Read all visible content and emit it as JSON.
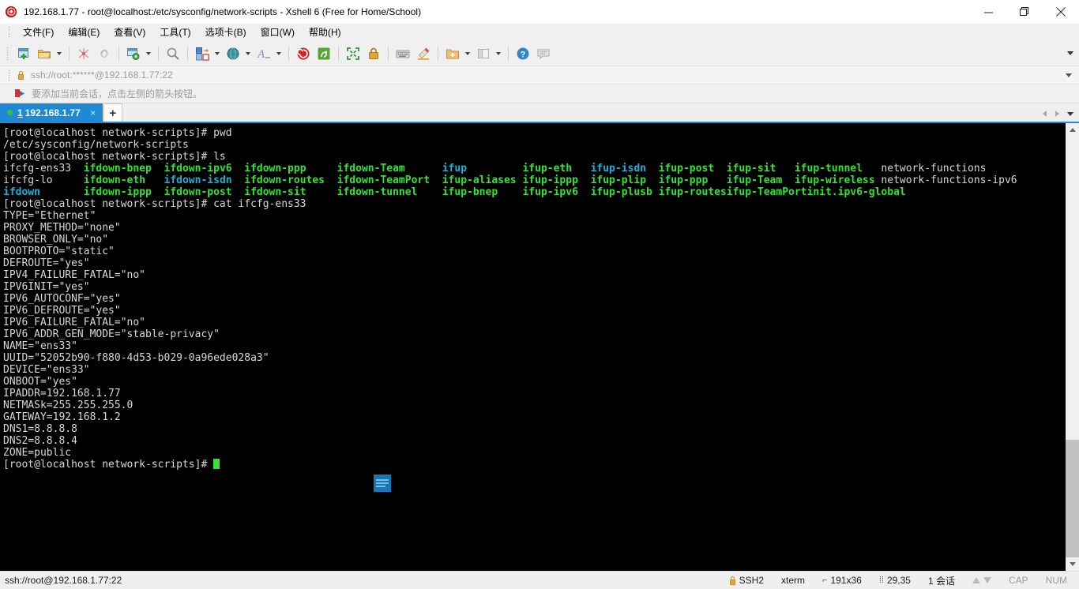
{
  "window": {
    "title": "192.168.1.77 - root@localhost:/etc/sysconfig/network-scripts - Xshell 6 (Free for Home/School)",
    "app_icon": "xshell-logo-icon",
    "minimize_label": "Minimize",
    "maximize_label": "Restore",
    "close_label": "Close"
  },
  "menubar": {
    "items": [
      {
        "label": "文件(F)",
        "name": "menu-file"
      },
      {
        "label": "编辑(E)",
        "name": "menu-edit"
      },
      {
        "label": "查看(V)",
        "name": "menu-view"
      },
      {
        "label": "工具(T)",
        "name": "menu-tools"
      },
      {
        "label": "选项卡(B)",
        "name": "menu-tabs"
      },
      {
        "label": "窗口(W)",
        "name": "menu-window"
      },
      {
        "label": "帮助(H)",
        "name": "menu-help"
      }
    ]
  },
  "toolbar": {
    "buttons": [
      {
        "name": "new-session-icon",
        "tip": "新建会话"
      },
      {
        "name": "open-folder-icon",
        "tip": "打开"
      },
      {
        "name": "disconnect-icon",
        "tip": "断开"
      },
      {
        "name": "reconnect-icon",
        "tip": "重新连接"
      },
      {
        "name": "properties-icon",
        "tip": "属性"
      },
      {
        "name": "find-icon",
        "tip": "查找"
      },
      {
        "name": "file-transfer-icon",
        "tip": "文件传输"
      },
      {
        "name": "globe-icon",
        "tip": "编码"
      },
      {
        "name": "font-icon",
        "tip": "字体"
      },
      {
        "name": "xshell-icon",
        "tip": "Xshell"
      },
      {
        "name": "xftp-icon",
        "tip": "Xftp"
      },
      {
        "name": "fullscreen-icon",
        "tip": "全屏"
      },
      {
        "name": "lock-icon",
        "tip": "锁定"
      },
      {
        "name": "keyboard-icon",
        "tip": "撰写栏"
      },
      {
        "name": "highlight-icon",
        "tip": "高亮"
      },
      {
        "name": "add-folder-icon",
        "tip": "新建文件夹"
      },
      {
        "name": "split-layout-icon",
        "tip": "排列"
      },
      {
        "name": "help-icon",
        "tip": "帮助"
      },
      {
        "name": "chat-icon",
        "tip": "消息"
      }
    ]
  },
  "addressbar": {
    "icon": "lock-icon",
    "value": "ssh://root:******@192.168.1.77:22",
    "placeholder": "ssh://root:******@192.168.1.77:22"
  },
  "notice": {
    "icon": "arrow-flag-icon",
    "text": "要添加当前会话，点击左侧的箭头按钮。"
  },
  "tabbar": {
    "tabs": [
      {
        "index": "1",
        "label": "192.168.1.77",
        "status": "connected",
        "close_label": "×"
      }
    ],
    "new_tab_label": "+",
    "scroll_left": "scroll-tabs-left-icon",
    "scroll_right": "scroll-tabs-right-icon",
    "tab_list": "tab-list-icon"
  },
  "terminal": {
    "float_icon": "compose-lines-icon",
    "lines": [
      {
        "type": "prompt",
        "prompt": "[root@localhost network-scripts]# ",
        "command": "pwd"
      },
      {
        "type": "plain",
        "text": "/etc/sysconfig/network-scripts"
      },
      {
        "type": "prompt",
        "prompt": "[root@localhost network-scripts]# ",
        "command": "ls"
      },
      {
        "type": "ls",
        "cells": [
          {
            "text": "ifcfg-ens33",
            "color": "white"
          },
          {
            "text": "ifdown-bnep",
            "color": "green"
          },
          {
            "text": "ifdown-ipv6",
            "color": "green"
          },
          {
            "text": "ifdown-ppp",
            "color": "green"
          },
          {
            "text": "ifdown-Team",
            "color": "green"
          },
          {
            "text": "ifup",
            "color": "cyan"
          },
          {
            "text": "ifup-eth",
            "color": "green"
          },
          {
            "text": "ifup-isdn",
            "color": "cyan"
          },
          {
            "text": "ifup-post",
            "color": "green"
          },
          {
            "text": "ifup-sit",
            "color": "green"
          },
          {
            "text": "ifup-tunnel",
            "color": "green"
          },
          {
            "text": "network-functions",
            "color": "white"
          }
        ]
      },
      {
        "type": "ls",
        "cells": [
          {
            "text": "ifcfg-lo",
            "color": "white"
          },
          {
            "text": "ifdown-eth",
            "color": "green"
          },
          {
            "text": "ifdown-isdn",
            "color": "cyan"
          },
          {
            "text": "ifdown-routes",
            "color": "green"
          },
          {
            "text": "ifdown-TeamPort",
            "color": "green"
          },
          {
            "text": "ifup-aliases",
            "color": "green"
          },
          {
            "text": "ifup-ippp",
            "color": "green"
          },
          {
            "text": "ifup-plip",
            "color": "green"
          },
          {
            "text": "ifup-ppp",
            "color": "green"
          },
          {
            "text": "ifup-Team",
            "color": "green"
          },
          {
            "text": "ifup-wireless",
            "color": "green"
          },
          {
            "text": "network-functions-ipv6",
            "color": "white"
          }
        ]
      },
      {
        "type": "ls",
        "cells": [
          {
            "text": "ifdown",
            "color": "cyan"
          },
          {
            "text": "ifdown-ippp",
            "color": "green"
          },
          {
            "text": "ifdown-post",
            "color": "green"
          },
          {
            "text": "ifdown-sit",
            "color": "green"
          },
          {
            "text": "ifdown-tunnel",
            "color": "green"
          },
          {
            "text": "ifup-bnep",
            "color": "green"
          },
          {
            "text": "ifup-ipv6",
            "color": "green"
          },
          {
            "text": "ifup-plusb",
            "color": "green"
          },
          {
            "text": "ifup-routes",
            "color": "green"
          },
          {
            "text": "ifup-TeamPort",
            "color": "green"
          },
          {
            "text": "init.ipv6-global",
            "color": "green"
          },
          {
            "text": "",
            "color": "white"
          }
        ]
      },
      {
        "type": "prompt",
        "prompt": "[root@localhost network-scripts]# ",
        "command": "cat ifcfg-ens33"
      },
      {
        "type": "plain",
        "text": "TYPE=\"Ethernet\""
      },
      {
        "type": "plain",
        "text": "PROXY_METHOD=\"none\""
      },
      {
        "type": "plain",
        "text": "BROWSER_ONLY=\"no\""
      },
      {
        "type": "plain",
        "text": "BOOTPROTO=\"static\""
      },
      {
        "type": "plain",
        "text": "DEFROUTE=\"yes\""
      },
      {
        "type": "plain",
        "text": "IPV4_FAILURE_FATAL=\"no\""
      },
      {
        "type": "plain",
        "text": "IPV6INIT=\"yes\""
      },
      {
        "type": "plain",
        "text": "IPV6_AUTOCONF=\"yes\""
      },
      {
        "type": "plain",
        "text": "IPV6_DEFROUTE=\"yes\""
      },
      {
        "type": "plain",
        "text": "IPV6_FAILURE_FATAL=\"no\""
      },
      {
        "type": "plain",
        "text": "IPV6_ADDR_GEN_MODE=\"stable-privacy\""
      },
      {
        "type": "plain",
        "text": "NAME=\"ens33\""
      },
      {
        "type": "plain",
        "text": "UUID=\"52052b90-f880-4d53-b029-0a96ede028a3\""
      },
      {
        "type": "plain",
        "text": "DEVICE=\"ens33\""
      },
      {
        "type": "plain",
        "text": "ONBOOT=\"yes\""
      },
      {
        "type": "plain",
        "text": "IPADDR=192.168.1.77"
      },
      {
        "type": "plain",
        "text": "NETMASk=255.255.255.0"
      },
      {
        "type": "plain",
        "text": "GATEWAY=192.168.1.2"
      },
      {
        "type": "plain",
        "text": "DNS1=8.8.8.8"
      },
      {
        "type": "plain",
        "text": "DNS2=8.8.8.4"
      },
      {
        "type": "plain",
        "text": "ZONE=public"
      },
      {
        "type": "cursor",
        "prompt": "[root@localhost network-scripts]# "
      }
    ],
    "colors": {
      "background": "#000000",
      "white": "#d8d8d8",
      "green": "#2ee62e",
      "cyan": "#18b2d9",
      "cursor": "#2ee62e"
    }
  },
  "statusbar": {
    "connection": "ssh://root@192.168.1.77:22",
    "protocol": "SSH2",
    "terminal_type": "xterm",
    "size": "191x36",
    "cursor_position": "29,35",
    "sessions": "1 会话",
    "caps": "CAP",
    "num": "NUM",
    "size_icon": "resize-icon",
    "position_icon": "cursor-position-icon",
    "lock_icon": "lock-icon",
    "upload_icon": "transfer-up-icon",
    "download_icon": "transfer-down-icon"
  }
}
